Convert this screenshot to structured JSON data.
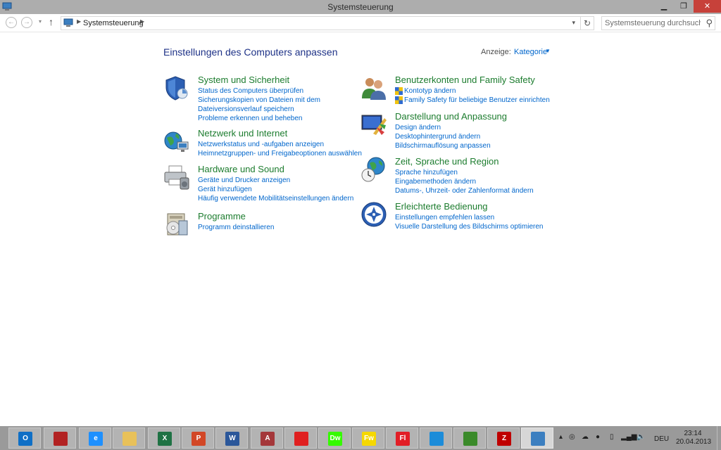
{
  "window": {
    "title": "Systemsteuerung"
  },
  "address": {
    "breadcrumb": "Systemsteuerung",
    "search_placeholder": "Systemsteuerung durchsuchen"
  },
  "main": {
    "heading": "Einstellungen des Computers anpassen",
    "view_label": "Anzeige:",
    "view_value": "Kategorie"
  },
  "categories": [
    {
      "title": "System und Sicherheit",
      "links": [
        "Status des Computers überprüfen",
        "Sicherungskopien von Dateien mit dem",
        "Dateiversionsverlauf speichern",
        "Probleme erkennen und beheben"
      ]
    },
    {
      "title": "Netzwerk und Internet",
      "links": [
        "Netzwerkstatus und -aufgaben anzeigen",
        "Heimnetzgruppen- und Freigabeoptionen auswählen"
      ]
    },
    {
      "title": "Hardware und Sound",
      "links": [
        "Geräte und Drucker anzeigen",
        "Gerät hinzufügen",
        "Häufig verwendete Mobilitätseinstellungen ändern"
      ]
    },
    {
      "title": "Programme",
      "links": [
        "Programm deinstallieren"
      ]
    },
    {
      "title": "Benutzerkonten und Family Safety",
      "links": [
        "Kontotyp ändern",
        "Family Safety für beliebige Benutzer einrichten"
      ]
    },
    {
      "title": "Darstellung und Anpassung",
      "links": [
        "Design ändern",
        "Desktophintergrund ändern",
        "Bildschirmauflösung anpassen"
      ]
    },
    {
      "title": "Zeit, Sprache und Region",
      "links": [
        "Sprache hinzufügen",
        "Eingabemethoden ändern",
        "Datums-, Uhrzeit- oder Zahlenformat ändern"
      ]
    },
    {
      "title": "Erleichterte Bedienung",
      "links": [
        "Einstellungen empfehlen lassen",
        "Visuelle Darstellung des Bildschirms optimieren"
      ]
    }
  ],
  "taskbar": {
    "apps": [
      {
        "icon": "outlook-icon",
        "label": "O",
        "color": "#0f6fc6"
      },
      {
        "icon": "red-app-icon",
        "label": "",
        "color": "#b22222"
      },
      {
        "icon": "internet-explorer-icon",
        "label": "e",
        "color": "#1e90ff"
      },
      {
        "icon": "file-explorer-icon",
        "label": "",
        "color": "#e8c15a"
      },
      {
        "icon": "excel-icon",
        "label": "X",
        "color": "#1f7244"
      },
      {
        "icon": "powerpoint-icon",
        "label": "P",
        "color": "#d24726"
      },
      {
        "icon": "word-icon",
        "label": "W",
        "color": "#2b579a"
      },
      {
        "icon": "access-icon",
        "label": "A",
        "color": "#a4373a"
      },
      {
        "icon": "acrobat-icon",
        "label": "",
        "color": "#e02020"
      },
      {
        "icon": "dreamweaver-icon",
        "label": "Dw",
        "color": "#35fa00"
      },
      {
        "icon": "fireworks-icon",
        "label": "Fw",
        "color": "#f5d800"
      },
      {
        "icon": "flash-icon",
        "label": "Fl",
        "color": "#e21e26"
      },
      {
        "icon": "itunes-icon",
        "label": "",
        "color": "#1c8cd9"
      },
      {
        "icon": "green-tool-icon",
        "label": "",
        "color": "#3a8a2a"
      },
      {
        "icon": "filezilla-icon",
        "label": "Z",
        "color": "#bf0000"
      },
      {
        "icon": "control-panel-icon",
        "label": "",
        "color": "#3c7fc0"
      }
    ],
    "language": "DEU",
    "time": "23:14",
    "date": "20.04.2013"
  }
}
